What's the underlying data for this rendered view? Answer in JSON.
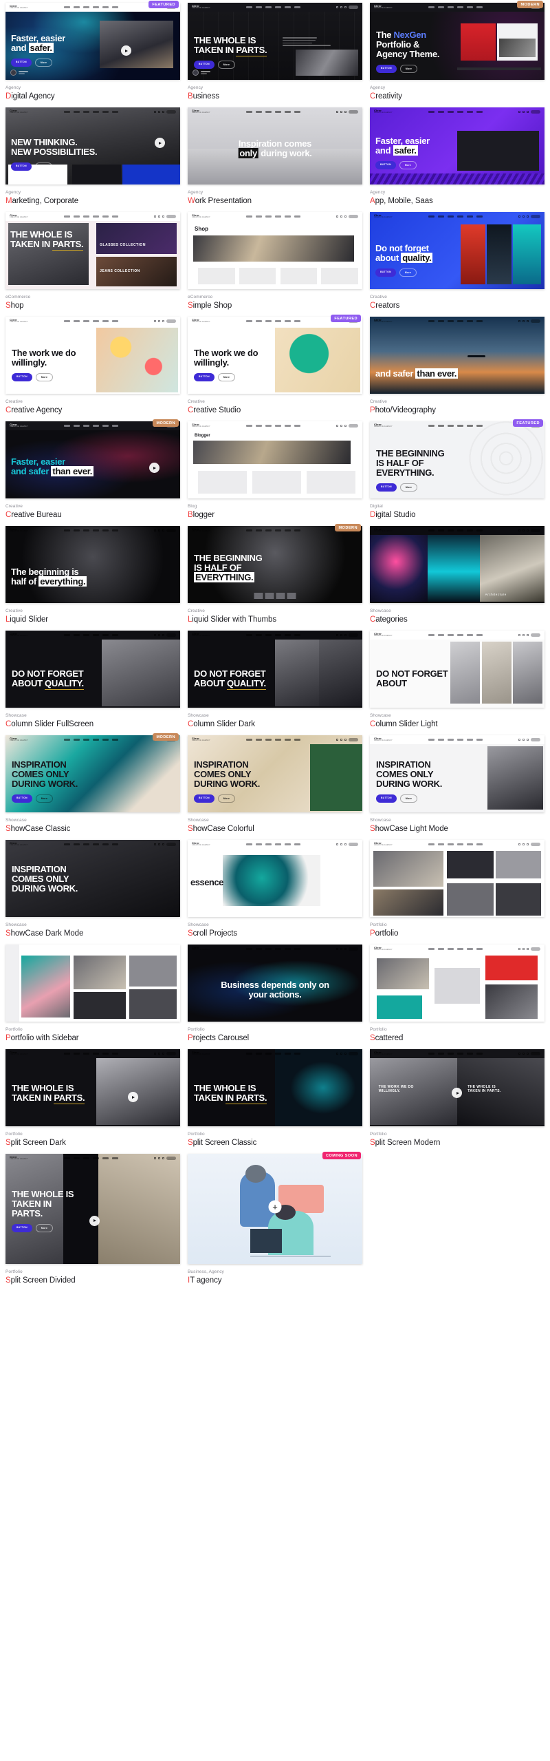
{
  "meta": {
    "accent_title_first_letter": "#f04141",
    "category_color": "#8e8e96",
    "badge_featured_color": "#8f5cf0",
    "badge_modern_color": "#c8895a",
    "badge_coming_soon_color": "#f0256f",
    "columns": 3
  },
  "badges": {
    "featured": "FEATURED",
    "modern": "MODERN",
    "coming_soon": "COMING SOON"
  },
  "brand": {
    "name": "Clevr",
    "tagline": "CREATIVE AGENCY"
  },
  "demos": [
    {
      "category": "Agency",
      "title": "Digital Agency",
      "badge": "FEATURED",
      "style": "digital-agency",
      "heroLines": [
        "Faster, easier",
        "and safer."
      ]
    },
    {
      "category": "Agency",
      "title": "Business",
      "badge": "",
      "style": "business",
      "heroLines": [
        "THE WHOLE IS",
        "TAKEN IN PARTS."
      ]
    },
    {
      "category": "Agency",
      "title": "Creativity",
      "badge": "MODERN",
      "style": "creativity",
      "heroLines": [
        "The NexGen",
        "Portfolio &",
        "Agency Theme."
      ]
    },
    {
      "category": "Agency",
      "title": "Marketing, Corporate",
      "badge": "",
      "style": "marketing",
      "heroLines": [
        "NEW THINKING.",
        "NEW POSSIBILITIES."
      ]
    },
    {
      "category": "Agency",
      "title": "Work Presentation",
      "badge": "",
      "style": "work-presentation",
      "heroLines": [
        "Inspiration comes",
        "only during work."
      ]
    },
    {
      "category": "Agency",
      "title": "App, Mobile, Saas",
      "badge": "",
      "style": "app-mobile",
      "heroLines": [
        "Faster, easier",
        "and safer."
      ]
    },
    {
      "category": "eCommerce",
      "title": "Shop",
      "badge": "",
      "style": "shop",
      "heroLines": [
        "THE WHOLE IS",
        "TAKEN IN PARTS."
      ]
    },
    {
      "category": "eCommerce",
      "title": "Simple Shop",
      "badge": "",
      "style": "simple-shop",
      "heroLines": [
        "Shop"
      ]
    },
    {
      "category": "Creative",
      "title": "Creators",
      "badge": "",
      "style": "creators",
      "heroLines": [
        "Do not forget",
        "about quality."
      ]
    },
    {
      "category": "Creative",
      "title": "Creative Agency",
      "badge": "",
      "style": "creative-agency",
      "heroLines": [
        "The work we do",
        "willingly."
      ]
    },
    {
      "category": "Creative",
      "title": "Creative Studio",
      "badge": "FEATURED",
      "style": "creative-studio",
      "heroLines": [
        "The work we do",
        "willingly."
      ]
    },
    {
      "category": "Creative",
      "title": "Photo/Videography",
      "badge": "",
      "style": "photo-video",
      "heroLines": [
        "and safer than ever."
      ]
    },
    {
      "category": "Creative",
      "title": "Creative Bureau",
      "badge": "MODERN",
      "style": "creative-bureau",
      "heroLines": [
        "Faster, easier",
        "and safer than ever."
      ]
    },
    {
      "category": "Blog",
      "title": "Blogger",
      "badge": "",
      "style": "blogger",
      "heroLines": [
        "Blogger"
      ]
    },
    {
      "category": "Digital",
      "title": "Digital Studio",
      "badge": "FEATURED",
      "style": "digital-studio",
      "heroLines": [
        "THE BEGINNING",
        "IS HALF OF",
        "EVERYTHING."
      ]
    },
    {
      "category": "Creative",
      "title": "Liquid Slider",
      "badge": "",
      "style": "liquid-slider",
      "heroLines": [
        "The beginning is",
        "half of everything."
      ]
    },
    {
      "category": "Creative",
      "title": "Liquid Slider with Thumbs",
      "badge": "MODERN",
      "style": "liquid-thumbs",
      "heroLines": [
        "THE BEGINNING",
        "IS HALF OF",
        "EVERYTHING."
      ]
    },
    {
      "category": "Showcase",
      "title": "Categories",
      "badge": "",
      "style": "categories",
      "heroLines": [
        "Architecture"
      ]
    },
    {
      "category": "Showcase",
      "title": "Column Slider FullScreen",
      "badge": "",
      "style": "col-full",
      "heroLines": [
        "DO NOT FORGET",
        "ABOUT QUALITY."
      ]
    },
    {
      "category": "Showcase",
      "title": "Column Slider Dark",
      "badge": "",
      "style": "col-dark",
      "heroLines": [
        "DO NOT FORGET",
        "ABOUT QUALITY."
      ]
    },
    {
      "category": "Showcase",
      "title": "Column Slider Light",
      "badge": "",
      "style": "col-light",
      "heroLines": [
        "DO NOT FORGET",
        "ABOUT"
      ]
    },
    {
      "category": "Showcase",
      "title": "ShowCase Classic",
      "badge": "MODERN",
      "style": "sc-classic",
      "heroLines": [
        "INSPIRATION",
        "COMES ONLY",
        "DURING WORK."
      ]
    },
    {
      "category": "Showcase",
      "title": "ShowCase Colorful",
      "badge": "",
      "style": "sc-colorful",
      "heroLines": [
        "INSPIRATION",
        "COMES ONLY",
        "DURING WORK."
      ]
    },
    {
      "category": "Showcase",
      "title": "ShowCase Light Mode",
      "badge": "",
      "style": "sc-light",
      "heroLines": [
        "INSPIRATION",
        "COMES ONLY",
        "DURING WORK."
      ]
    },
    {
      "category": "Showcase",
      "title": "ShowCase Dark Mode",
      "badge": "",
      "style": "sc-dark",
      "heroLines": [
        "INSPIRATION",
        "COMES ONLY",
        "DURING WORK."
      ]
    },
    {
      "category": "Showcase",
      "title": "Scroll Projects",
      "badge": "",
      "style": "scroll-projects",
      "heroLines": [
        "essence"
      ]
    },
    {
      "category": "Portfolio",
      "title": "Portfolio",
      "badge": "",
      "style": "portfolio",
      "heroLines": []
    },
    {
      "category": "Portfolio",
      "title": "Portfolio with Sidebar",
      "badge": "",
      "style": "portfolio-sidebar",
      "heroLines": []
    },
    {
      "category": "Portfolio",
      "title": "Projects Carousel",
      "badge": "",
      "style": "projects-carousel",
      "heroLines": [
        "Business depends only on",
        "your actions."
      ]
    },
    {
      "category": "Portfolio",
      "title": "Scattered",
      "badge": "",
      "style": "scattered",
      "heroLines": []
    },
    {
      "category": "Portfolio",
      "title": "Split Screen Dark",
      "badge": "",
      "style": "ss-dark",
      "heroLines": [
        "THE WHOLE IS",
        "TAKEN IN PARTS."
      ]
    },
    {
      "category": "Portfolio",
      "title": "Split Screen Classic",
      "badge": "",
      "style": "ss-classic",
      "heroLines": [
        "THE WHOLE IS",
        "TAKEN IN PARTS."
      ]
    },
    {
      "category": "Portfolio",
      "title": "Split Screen Modern",
      "badge": "",
      "style": "ss-modern",
      "heroLines": [
        "THE WORK WE DO WILLINGLY.",
        "THE WHOLE IS TAKEN IN PARTS."
      ]
    },
    {
      "category": "Portfolio",
      "title": "Split Screen Divided",
      "badge": "",
      "style": "ss-divided",
      "heroLines": [
        "THE WHOLE IS",
        "TAKEN IN",
        "PARTS."
      ]
    },
    {
      "category": "Business, Agency",
      "title": "IT agency",
      "badge": "COMING SOON",
      "style": "it-agency",
      "heroLines": []
    }
  ]
}
